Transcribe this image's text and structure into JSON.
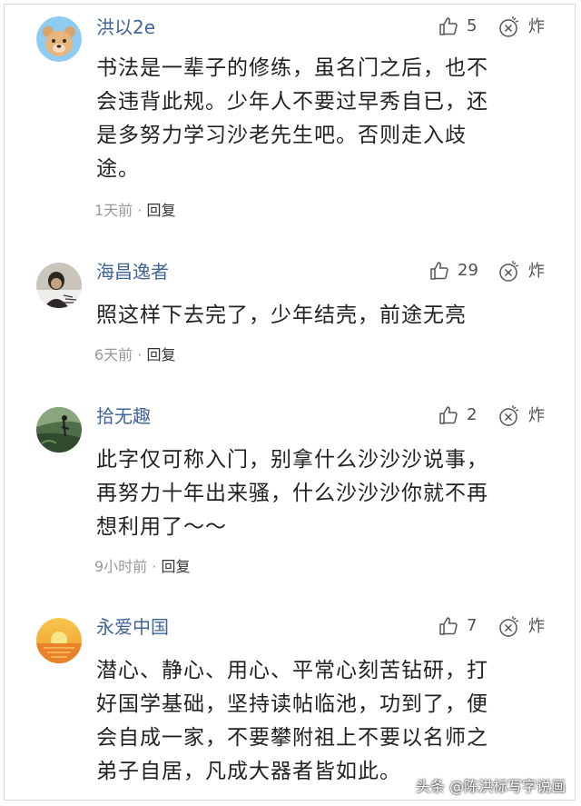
{
  "comments": [
    {
      "username": "洪以2e",
      "likes": "5",
      "report_label": "炸",
      "text": "书法是一辈子的修练，虽名门之后，也不\n会违背此规。少年人不要过早秀自已，还\n是多努力学习沙老先生吧。否则走入歧\n途。",
      "time": "1天前",
      "separator": "·",
      "reply_label": "回复",
      "avatar": "bear-avatar"
    },
    {
      "username": "海昌逸者",
      "likes": "29",
      "report_label": "炸",
      "text": "照这样下去完了，少年结壳，前途无亮",
      "time": "6天前",
      "separator": "·",
      "reply_label": "回复",
      "avatar": "calligraphy-photo-avatar"
    },
    {
      "username": "拾无趣",
      "likes": "2",
      "report_label": "炸",
      "text": "此字仅可称入门，别拿什么沙沙沙说事，\n再努力十年出来骚，什么沙沙沙你就不再\n想利用了～～",
      "time": "9小时前",
      "separator": "·",
      "reply_label": "回复",
      "avatar": "nature-photo-avatar"
    },
    {
      "username": "永爱中国",
      "likes": "7",
      "report_label": "炸",
      "text": "潜心、静心、用心、平常心刻苦钻研，打\n好国学基础，坚持读帖临池，功到了，便\n会自成一家，不要攀附祖上不要以名师之\n弟子自居，凡成大器者皆如此。",
      "time": "",
      "separator": "",
      "reply_label": "",
      "avatar": "sunset-avatar"
    }
  ],
  "watermark": "头条 @陈洪标写字说画",
  "icons": {
    "like": "thumbs-up-icon",
    "report": "report-icon"
  },
  "colors": {
    "username": "#406599",
    "meta": "#999999",
    "text": "#222222"
  }
}
